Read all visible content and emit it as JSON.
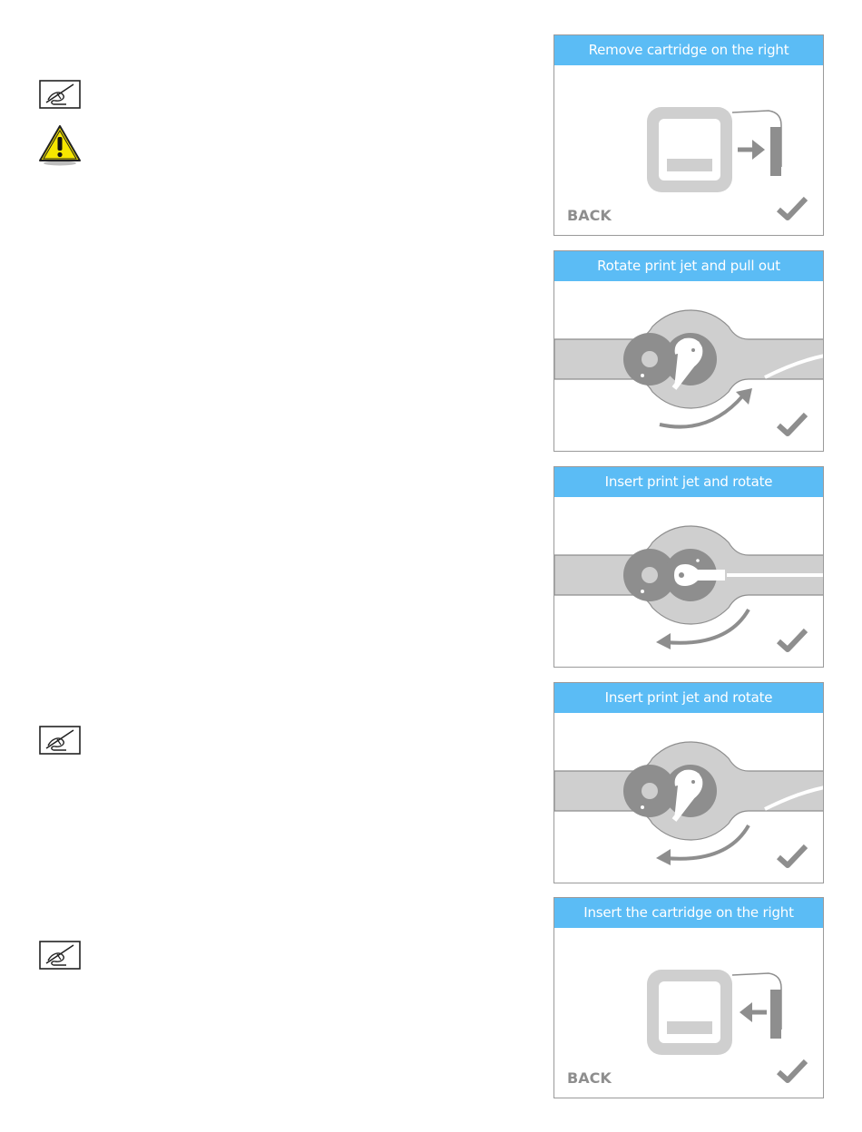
{
  "icons": {
    "note": "pencil-note-icon",
    "warning": "warning-triangle-icon",
    "confirm": "checkmark-icon"
  },
  "colors": {
    "header_blue": "#5bbcf5",
    "graphic_gray": "#8e8e8e",
    "light_gray": "#cfcfcf",
    "warning_yellow": "#f6e600"
  },
  "panels": [
    {
      "title": "Remove cartridge on the right",
      "back_label": "BACK"
    },
    {
      "title": "Rotate print jet and pull out"
    },
    {
      "title": "Insert print jet and rotate"
    },
    {
      "title": "Insert print jet and rotate"
    },
    {
      "title": "Insert the cartridge on the right",
      "back_label": "BACK"
    }
  ]
}
